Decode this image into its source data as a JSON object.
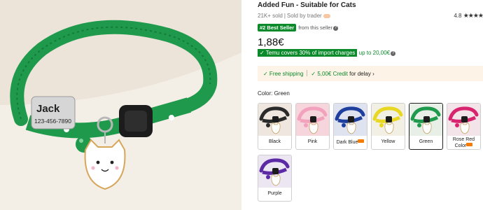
{
  "product": {
    "title": "Added Fun - Suitable for Cats",
    "sold": "21K+ sold",
    "sold_by": "Sold by trader",
    "rating_value": "4.8",
    "rating_stars": 4.8,
    "best_seller_badge": "#2 Best Seller",
    "best_seller_text": "from this seller",
    "price": "1,88€",
    "import_note": "✓ Temu covers 30% of import charges",
    "import_limit": "up to 20,00€",
    "free_shipping": "✓ Free shipping",
    "credit": "✓ 5,00€ Credit",
    "credit_suffix": "for delay",
    "color_label": "Color: Green"
  },
  "image": {
    "collar_name": "Jack",
    "collar_phone": "123-456-7890",
    "collar_color": "#1f9a4c"
  },
  "swatches": [
    {
      "label": "Black",
      "color": "#2a2a2a",
      "bg": "#efe7df",
      "selected": false,
      "hot": false
    },
    {
      "label": "Pink",
      "color": "#f2a2bd",
      "bg": "#f6d6dc",
      "selected": false,
      "hot": false
    },
    {
      "label": "Dark Blue",
      "color": "#1f3f9e",
      "bg": "#dfe3ef",
      "selected": false,
      "hot": true
    },
    {
      "label": "Yellow",
      "color": "#e8d823",
      "bg": "#f2efe4",
      "selected": false,
      "hot": false
    },
    {
      "label": "Green",
      "color": "#1f9a4c",
      "bg": "#e7efe6",
      "selected": true,
      "hot": false
    },
    {
      "label": "Rose Red Color",
      "color": "#d8246e",
      "bg": "#f3e4ea",
      "selected": false,
      "hot": true
    },
    {
      "label": "Purple",
      "color": "#5d2aa6",
      "bg": "#ece6f2",
      "selected": false,
      "hot": false
    }
  ],
  "colors": {
    "accent_green": "#0b8a2b",
    "shipping_bg": "#fdf3e6"
  }
}
